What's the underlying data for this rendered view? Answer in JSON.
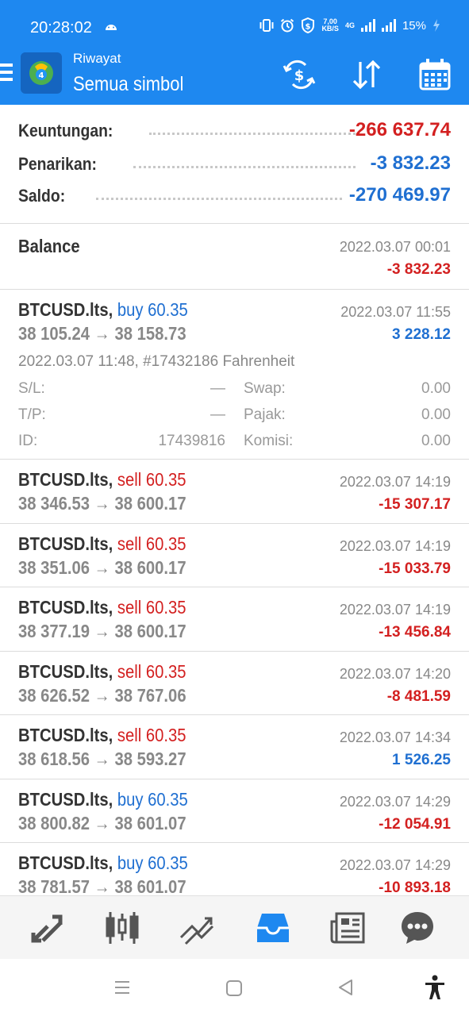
{
  "status_bar": {
    "time": "20:28:02",
    "speed_value": "7,00",
    "speed_unit": "KB/S",
    "network": "4G",
    "battery": "15%"
  },
  "toolbar": {
    "subtitle": "Riwayat",
    "title": "Semua simbol",
    "icons": [
      "menu-icon",
      "app-logo",
      "currency-exchange-icon",
      "sort-icon",
      "calendar-icon"
    ]
  },
  "summary": {
    "profit_label": "Keuntungan:",
    "profit_value": "-266 637.74",
    "withdrawal_label": "Penarikan:",
    "withdrawal_value": "-3 832.23",
    "balance_label": "Saldo:",
    "balance_value": "-270 469.97"
  },
  "balance_item": {
    "label": "Balance",
    "date": "2022.03.07 00:01",
    "amount": "-3 832.23"
  },
  "expanded_trade": {
    "symbol": "BTCUSD.lts,",
    "side": "buy 60.35",
    "price": "38 105.24 → 38 158.73",
    "date": "2022.03.07 11:55",
    "profit": "3 228.12",
    "open_info": "2022.03.07 11:48, #17432186 Fahrenheit",
    "sl_label": "S/L:",
    "sl_value": "—",
    "swap_label": "Swap:",
    "swap_value": "0.00",
    "tp_label": "T/P:",
    "tp_value": "—",
    "tax_label": "Pajak:",
    "tax_value": "0.00",
    "id_label": "ID:",
    "id_value": "17439816",
    "commission_label": "Komisi:",
    "commission_value": "0.00"
  },
  "trades": [
    {
      "symbol": "BTCUSD.lts,",
      "side": "sell 60.35",
      "price": "38 346.53 → 38 600.17",
      "date": "2022.03.07 14:19",
      "profit": "-15 307.17"
    },
    {
      "symbol": "BTCUSD.lts,",
      "side": "sell 60.35",
      "price": "38 351.06 → 38 600.17",
      "date": "2022.03.07 14:19",
      "profit": "-15 033.79"
    },
    {
      "symbol": "BTCUSD.lts,",
      "side": "sell 60.35",
      "price": "38 377.19 → 38 600.17",
      "date": "2022.03.07 14:19",
      "profit": "-13 456.84"
    },
    {
      "symbol": "BTCUSD.lts,",
      "side": "sell 60.35",
      "price": "38 626.52 → 38 767.06",
      "date": "2022.03.07 14:20",
      "profit": "-8 481.59"
    },
    {
      "symbol": "BTCUSD.lts,",
      "side": "sell 60.35",
      "price": "38 618.56 → 38 593.27",
      "date": "2022.03.07 14:34",
      "profit": "1 526.25"
    },
    {
      "symbol": "BTCUSD.lts,",
      "side": "buy 60.35",
      "price": "38 800.82 → 38 601.07",
      "date": "2022.03.07 14:29",
      "profit": "-12 054.91"
    },
    {
      "symbol": "BTCUSD.lts,",
      "side": "buy 60.35",
      "price": "38 781.57 → 38 601.07",
      "date": "2022.03.07 14:29",
      "profit": "-10 893.18"
    }
  ],
  "bottom_nav": {
    "items": [
      "quotes-icon",
      "chart-icon",
      "trade-icon",
      "history-icon",
      "news-icon",
      "chat-icon"
    ],
    "active": "history-icon",
    "active_color": "#1e88f0"
  },
  "colors": {
    "header": "#1e88f0",
    "loss": "#d32020",
    "gain": "#1f6fd1"
  }
}
